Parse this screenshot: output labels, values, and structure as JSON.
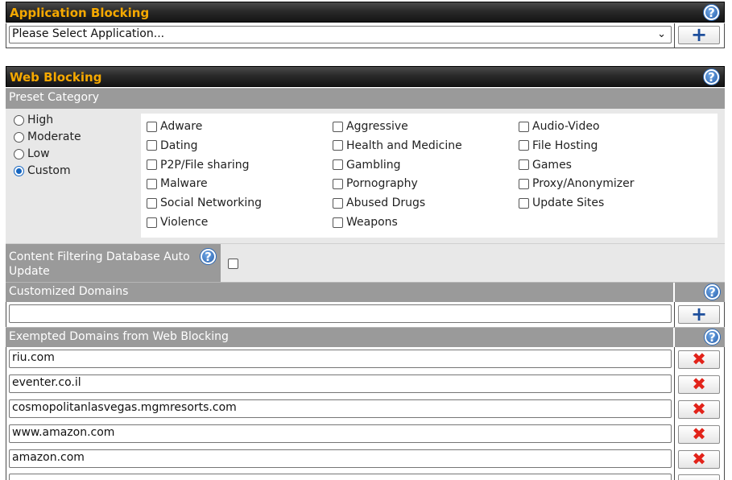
{
  "app_blocking": {
    "title": "Application Blocking",
    "select_value": "Please Select Application...",
    "help_glyph": "?",
    "add_glyph": "+"
  },
  "web_blocking": {
    "title": "Web Blocking",
    "help_glyph": "?"
  },
  "preset_category": {
    "label": "Preset Category",
    "levels": [
      {
        "label": "High",
        "selected": false
      },
      {
        "label": "Moderate",
        "selected": false
      },
      {
        "label": "Low",
        "selected": false
      },
      {
        "label": "Custom",
        "selected": true
      }
    ],
    "categories": [
      [
        "Adware",
        "Aggressive",
        "Audio-Video"
      ],
      [
        "Dating",
        "Health and Medicine",
        "File Hosting"
      ],
      [
        "P2P/File sharing",
        "Gambling",
        "Games"
      ],
      [
        "Malware",
        "Pornography",
        "Proxy/Anonymizer"
      ],
      [
        "Social Networking",
        "Abused Drugs",
        "Update Sites"
      ],
      [
        "Violence",
        "Weapons",
        ""
      ]
    ]
  },
  "content_filtering": {
    "label_line1": "Content Filtering Database Auto",
    "label_line2": "Update",
    "help_glyph": "?",
    "checked": false
  },
  "customized_domains": {
    "label": "Customized Domains",
    "help_glyph": "?",
    "input_value": "",
    "add_glyph": "+"
  },
  "exempted_domains": {
    "label": "Exempted Domains from Web Blocking",
    "help_glyph": "?",
    "remove_glyph": "✖",
    "items": [
      "riu.com",
      "eventer.co.il",
      "cosmopolitanlasvegas.mgmresorts.com",
      "www.amazon.com",
      "amazon.com"
    ]
  },
  "colors": {
    "header_title": "#f5a800",
    "subheader_bg": "#9a9a9a",
    "add_icon": "#1e4f9c",
    "remove_icon": "#e2231a",
    "help_icon": "#2a63b0"
  }
}
